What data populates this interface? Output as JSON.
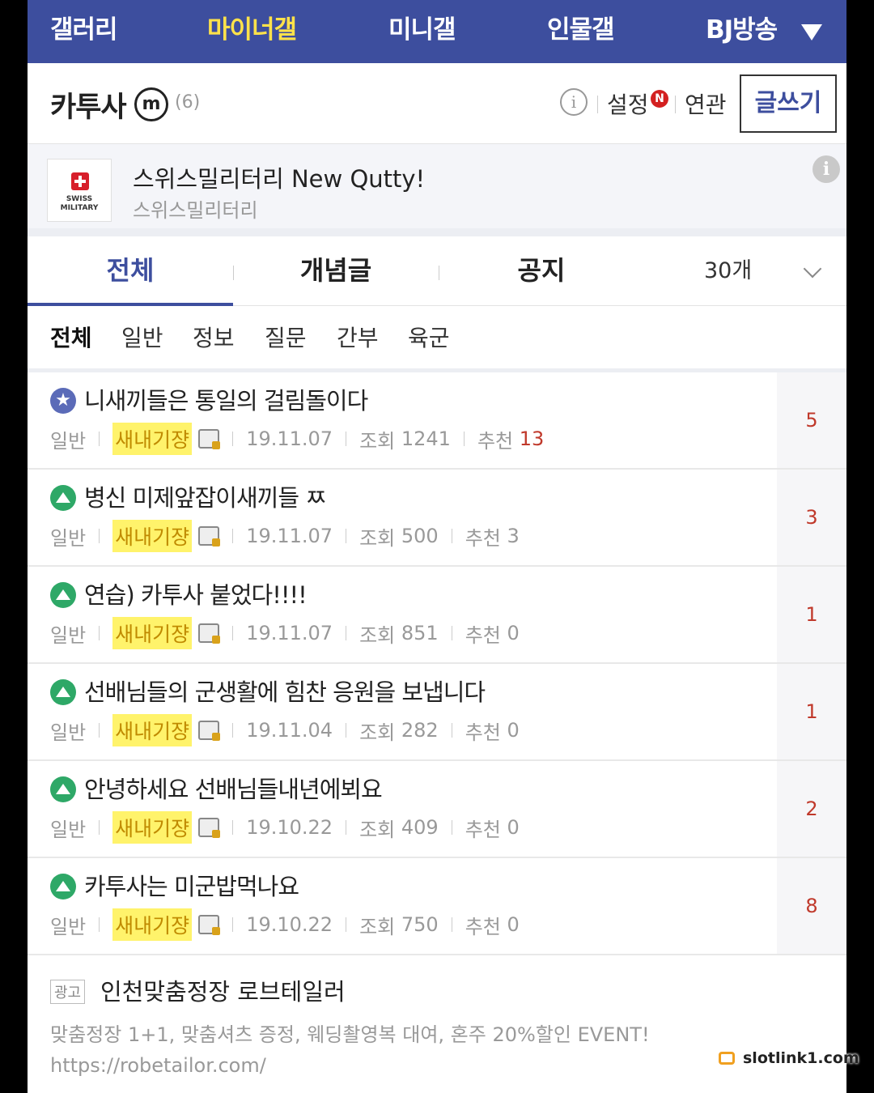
{
  "topnav": {
    "items": [
      {
        "label": "갤러리",
        "active": false
      },
      {
        "label": "마이너갤",
        "active": true
      },
      {
        "label": "미니갤",
        "active": false
      },
      {
        "label": "인물갤",
        "active": false
      },
      {
        "label": "BJ방송",
        "active": false
      }
    ],
    "dropdown_icon": "triangle-down-icon"
  },
  "gallery": {
    "title": "카투사",
    "badge": "m",
    "count": "(6)",
    "setting": "설정",
    "new_badge": "N",
    "related": "연관",
    "write": "글쓰기"
  },
  "banner": {
    "logo_text": "SWISS MILITARY",
    "title": "스위스밀리터리 New Qutty!",
    "subtitle": "스위스밀리터리"
  },
  "tabs": {
    "items": [
      "전체",
      "개념글",
      "공지"
    ],
    "active_index": 0,
    "count_select": "30개"
  },
  "categories": {
    "items": [
      "전체",
      "일반",
      "정보",
      "질문",
      "간부",
      "육군"
    ],
    "active_index": 0
  },
  "posts": [
    {
      "icon": "star-icon",
      "title": "니새끼들은 통일의 걸림돌이다",
      "category": "일반",
      "author": "새내기쟝",
      "date": "19.11.07",
      "views_label": "조회",
      "views": "1241",
      "rec_label": "추천",
      "rec": "13",
      "comments": "5"
    },
    {
      "icon": "image-icon",
      "title": "병신 미제앞잡이새끼들 ㅉ",
      "category": "일반",
      "author": "새내기쟝",
      "date": "19.11.07",
      "views_label": "조회",
      "views": "500",
      "rec_label": "추천",
      "rec": "3",
      "comments": "3"
    },
    {
      "icon": "image-icon",
      "title": "연습) 카투사 붙었다!!!!",
      "category": "일반",
      "author": "새내기쟝",
      "date": "19.11.07",
      "views_label": "조회",
      "views": "851",
      "rec_label": "추천",
      "rec": "0",
      "comments": "1"
    },
    {
      "icon": "image-icon",
      "title": "선배님들의 군생활에 힘찬 응원을 보냅니다",
      "category": "일반",
      "author": "새내기쟝",
      "date": "19.11.04",
      "views_label": "조회",
      "views": "282",
      "rec_label": "추천",
      "rec": "0",
      "comments": "1"
    },
    {
      "icon": "image-icon",
      "title": "안녕하세요 선배님들내년에뵈요",
      "category": "일반",
      "author": "새내기쟝",
      "date": "19.10.22",
      "views_label": "조회",
      "views": "409",
      "rec_label": "추천",
      "rec": "0",
      "comments": "2"
    },
    {
      "icon": "image-icon",
      "title": "카투사는 미군밥먹나요",
      "category": "일반",
      "author": "새내기쟝",
      "date": "19.10.22",
      "views_label": "조회",
      "views": "750",
      "rec_label": "추천",
      "rec": "0",
      "comments": "8"
    }
  ],
  "ad": {
    "tag": "광고",
    "title": "인천맞춤정장 로브테일러",
    "desc": "맞춤정장 1+1, 맞춤셔츠 증정, 웨딩촬영복 대여, 혼주 20%할인 EVENT!",
    "url": "https://robetailor.com/"
  },
  "watermark": "slotlink1.com",
  "colors": {
    "nav_bg": "#3d4e9e",
    "nav_active": "#ffe24a",
    "author_highlight": "#fff36b",
    "comment_count": "#c0392b"
  }
}
